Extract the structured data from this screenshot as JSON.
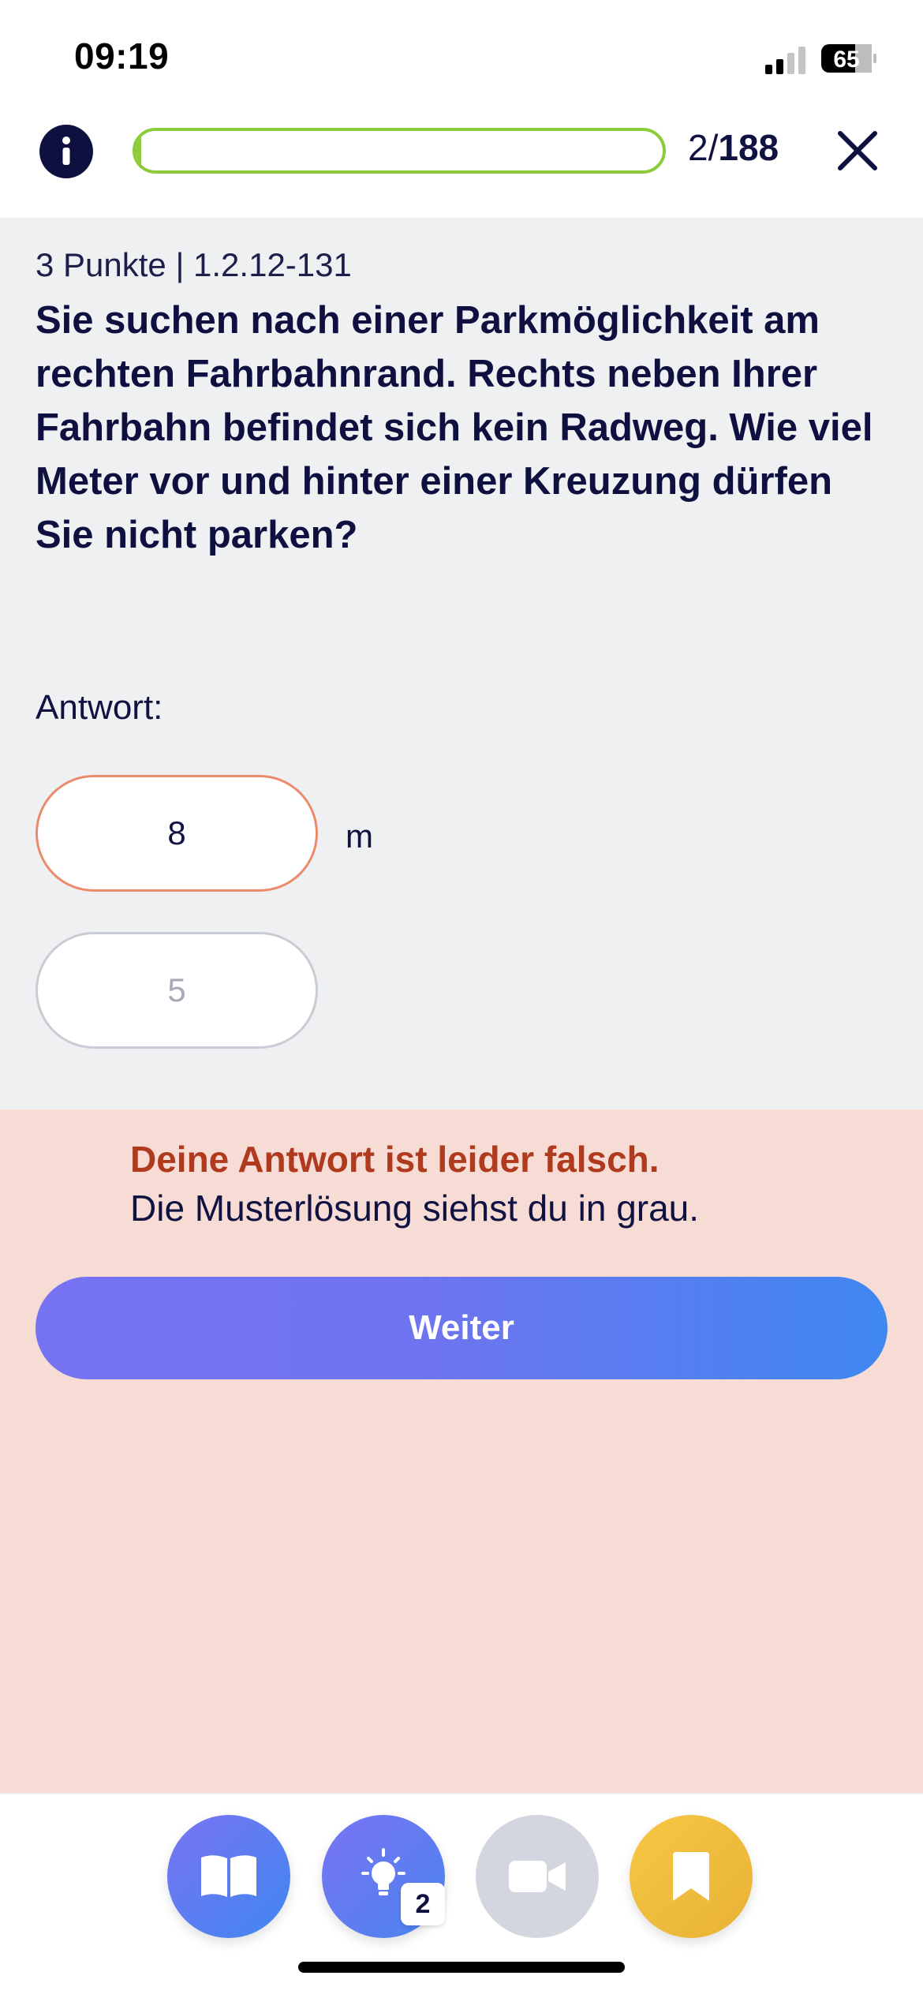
{
  "status_bar": {
    "time": "09:19",
    "battery_level": "65",
    "signal_icon": "cellular-signal-icon",
    "battery_icon": "battery-icon"
  },
  "header": {
    "info_icon": "info-icon",
    "progress_fraction": 0.0106,
    "progress_color": "#8ccc3b",
    "current": "2/",
    "total": "188",
    "close_icon": "close-icon"
  },
  "question": {
    "meta": "3 Punkte | 1.2.12-131",
    "text": "Sie suchen nach einer Parkmöglichkeit am rechten Fahrbahnrand. Rechts neben Ihrer Fahrbahn befindet sich kein Radweg. Wie viel Meter vor und hinter einer Kreuzung dürfen Sie nicht parken?",
    "answer_label": "Antwort:",
    "user_answer": "8",
    "unit": "m",
    "correct_answer": "5"
  },
  "feedback": {
    "title": "Deine Antwort ist leider falsch.",
    "subtitle": "Die Musterlösung siehst du in grau.",
    "title_color": "#b03a1d",
    "background_color": "#f7dcd6",
    "next_label": "Weiter"
  },
  "toolbar": {
    "items": [
      {
        "icon": "book-icon"
      },
      {
        "icon": "lightbulb-icon",
        "badge": "2"
      },
      {
        "icon": "video-camera-icon"
      },
      {
        "icon": "bookmark-icon"
      }
    ]
  },
  "colors": {
    "primary_dark": "#0e1140",
    "accent_gradient_start": "#7673f2",
    "accent_gradient_end": "#3f87f0",
    "bookmark_yellow": "#f6c744"
  }
}
